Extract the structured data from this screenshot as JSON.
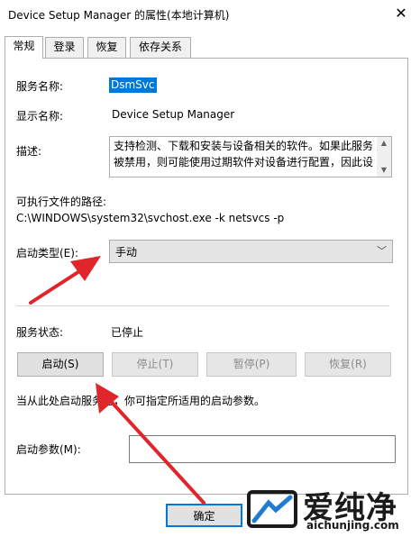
{
  "window": {
    "title": "Device Setup Manager 的属性(本地计算机)",
    "close_glyph": "✕"
  },
  "tabs": [
    {
      "label": "常规",
      "active": true
    },
    {
      "label": "登录",
      "active": false
    },
    {
      "label": "恢复",
      "active": false
    },
    {
      "label": "依存关系",
      "active": false
    }
  ],
  "general": {
    "service_name_label": "服务名称:",
    "service_name_value": "DsmSvc",
    "display_name_label": "显示名称:",
    "display_name_value": "Device Setup Manager",
    "description_label": "描述:",
    "description_text": "支持检测、下载和安装与设备相关的软件。如果此服务\n被禁用，则可能使用过期软件对设备进行配置，因此设",
    "exe_path_label": "可执行文件的路径:",
    "exe_path_value": "C:\\WINDOWS\\system32\\svchost.exe -k netsvcs -p",
    "startup_type_label": "启动类型(E):",
    "startup_type_value": "手动",
    "status_label": "服务状态:",
    "status_value": "已停止",
    "buttons": {
      "start": "启动(S)",
      "stop": "停止(T)",
      "pause": "暂停(P)",
      "resume": "恢复(R)"
    },
    "hint": "当从此处启动服务时，你可指定所适用的启动参数。",
    "start_params_label": "启动参数(M):",
    "start_params_value": ""
  },
  "footer": {
    "ok_label": "确定"
  },
  "watermark": {
    "brand": "爱纯净",
    "url": "aichunjing.com"
  },
  "colors": {
    "selection": "#0078d7",
    "annotation_arrow": "#e0262b",
    "watermark_accent": "#1f7ccf"
  }
}
